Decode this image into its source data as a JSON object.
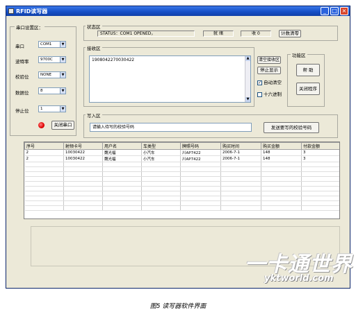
{
  "window": {
    "title": "RFID读写器"
  },
  "port_settings": {
    "group_label": "串口设置区：",
    "port_label": "串口",
    "port_value": "COM1",
    "baud_label": "波特率",
    "baud_value": "9700C",
    "parity_label": "校验位",
    "parity_value": "NONE",
    "databits_label": "数据位",
    "databits_value": "8",
    "stopbits_label": "停止位",
    "stopbits_value": "1",
    "close_button": "关闭串口"
  },
  "status_area": {
    "group_label": "状态区",
    "status_text": "STATUS：COM1 OPENED，",
    "field2": "就 绪",
    "field3": "收 0",
    "clear_count_button": "计数清零"
  },
  "read_area": {
    "group_label": "接收区",
    "content": "1908042270030422",
    "clear_button": "清空接收区",
    "stop_button": "停止显示",
    "auto_clear_label": "自动清空",
    "auto_clear_checked": true,
    "hex_label": "十六进制",
    "hex_checked": false
  },
  "function_area": {
    "group_label": "功能区",
    "help_button": "帮 助",
    "close_program_button": "关闭程序"
  },
  "write_area": {
    "group_label": "写入区",
    "input_value": "请输入待写的校验号码",
    "send_button": "发送要写的校验号码"
  },
  "table": {
    "headers": [
      "序号",
      "射频卡号",
      "用户名",
      "车类型",
      "牌照号码",
      "购买时间",
      "购买金额",
      "付款金额"
    ],
    "rows": [
      [
        "2",
        "10030422",
        "魏光福",
        "小汽车",
        "川AP7422",
        "2006-7-1",
        "148",
        "3"
      ],
      [
        "2",
        "10030422",
        "魏光福",
        "小汽车",
        "川AP7422",
        "2006-7-1",
        "148",
        "3"
      ]
    ]
  },
  "watermark": {
    "line1": "一卡通世界",
    "line2": "yktworld.com"
  },
  "caption": "图5 读写器软件界面"
}
